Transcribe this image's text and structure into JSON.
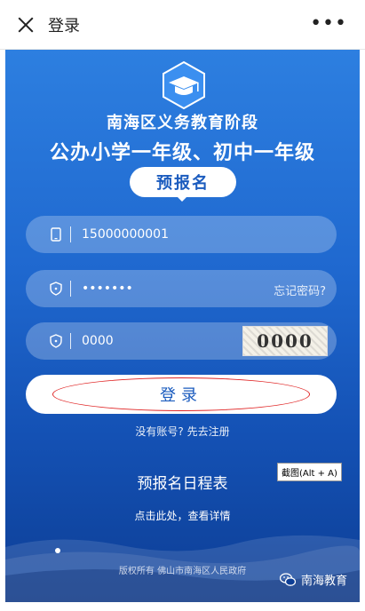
{
  "topbar": {
    "title": "登录"
  },
  "header": {
    "title_line1": "南海区义务教育阶段",
    "title_line2": "公办小学一年级、初中一年级",
    "badge": "预报名"
  },
  "form": {
    "phone_value": "15000000001",
    "password_value": "•••••••",
    "forgot_label": "忘记密码?",
    "captcha_value": "0000",
    "captcha_image_text": "0000",
    "login_label": "登录"
  },
  "links": {
    "register": "没有账号? 先去注册",
    "schedule": "预报名日程表",
    "details": "点击此处，查看详情"
  },
  "tooltip": "截图(Alt + A)",
  "footer": {
    "copyright": "版权所有 佛山市南海区人民政府",
    "watermark": "南海教育"
  },
  "colors": {
    "primary": "#1f68cf",
    "accent_text": "#1a5bbe",
    "highlight": "#e02424"
  }
}
